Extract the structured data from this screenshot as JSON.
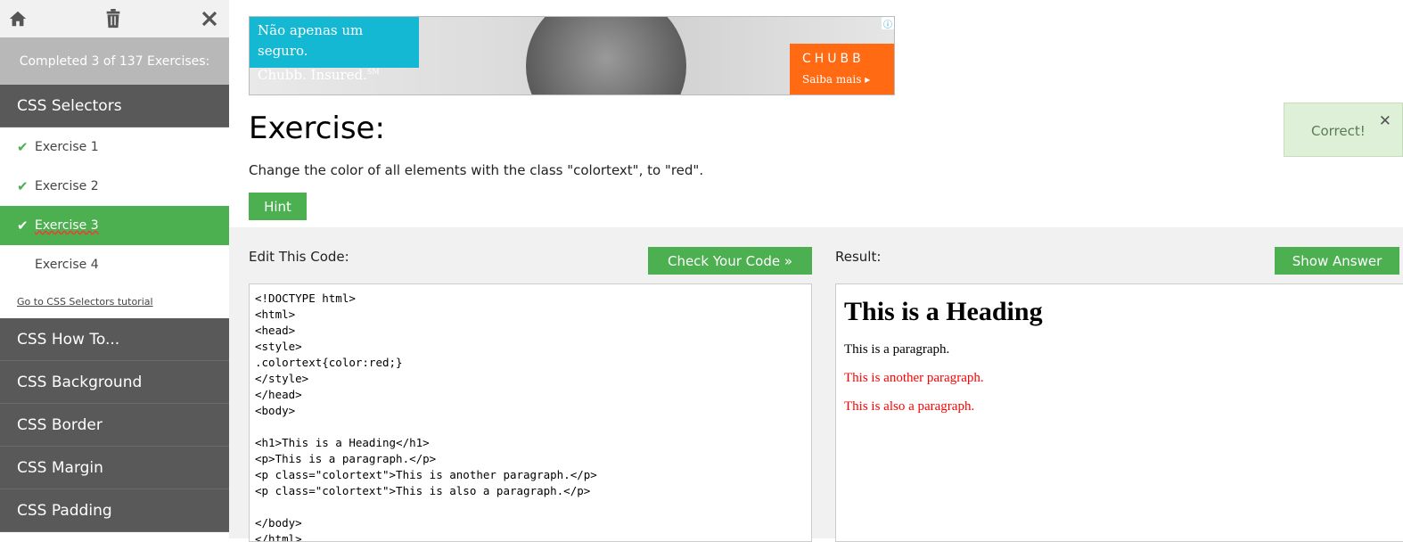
{
  "sidebar": {
    "icons": [
      "home-icon",
      "trash-icon",
      "close-icon"
    ],
    "progress": "Completed 3 of 137 Exercises:",
    "current_section": "CSS Selectors",
    "exercises": [
      {
        "label": "Exercise 1",
        "done": true
      },
      {
        "label": "Exercise 2",
        "done": true
      },
      {
        "label": "Exercise 3",
        "done": true,
        "active": true
      },
      {
        "label": "Exercise 4",
        "done": false
      }
    ],
    "tutorial_link": "Go to CSS Selectors tutorial",
    "sections": [
      "CSS How To...",
      "CSS Background",
      "CSS Border",
      "CSS Margin",
      "CSS Padding"
    ]
  },
  "ad": {
    "headline_line1": "Não apenas um seguro.",
    "headline_line2": "Chubb. Insured.",
    "trademark": "SM",
    "brand": "CHUBB",
    "cta": "Saiba mais ▸",
    "info": "ⓘ"
  },
  "exercise": {
    "title": "Exercise:",
    "description": "Change the color of all elements with the class \"colortext\", to \"red\".",
    "hint_label": "Hint"
  },
  "toast": {
    "message": "Correct!",
    "close": "✕"
  },
  "editor": {
    "label": "Edit This Code:",
    "check_label": "Check Your Code »",
    "lines": [
      "<!DOCTYPE html>",
      "<html>",
      "<head>",
      "<style>",
      ".colortext{color:red;}",
      "</style>",
      "</head>",
      "<body>",
      "",
      "<h1>This is a Heading</h1>",
      "<p>This is a paragraph.</p>",
      "<p class=\"colortext\">This is another paragraph.</p>",
      "<p class=\"colortext\">This is also a paragraph.</p>",
      "",
      "</body>",
      "</html>"
    ]
  },
  "result": {
    "label": "Result:",
    "answer_label": "Show Answer",
    "heading": "This is a Heading",
    "p1": "This is a paragraph.",
    "p2": "This is another paragraph.",
    "p3": "This is also a paragraph."
  },
  "colors": {
    "accent": "#4caf50",
    "sidebar_dark": "#595959",
    "toast_bg": "#dff0d8",
    "result_red": "#ff0000"
  }
}
